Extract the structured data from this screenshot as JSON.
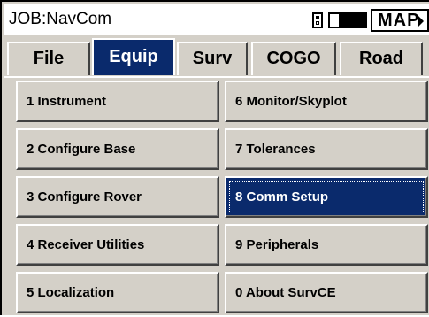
{
  "titlebar": {
    "job_title": "JOB:NavCom",
    "map_label": "MAP"
  },
  "tabs": [
    {
      "label": "File",
      "active": false
    },
    {
      "label": "Equip",
      "active": true
    },
    {
      "label": "Surv",
      "active": false
    },
    {
      "label": "COGO",
      "active": false
    },
    {
      "label": "Road",
      "active": false
    }
  ],
  "menu": {
    "left": [
      {
        "label": "1 Instrument"
      },
      {
        "label": "2 Configure Base"
      },
      {
        "label": "3 Configure Rover"
      },
      {
        "label": "4 Receiver Utilities"
      },
      {
        "label": "5 Localization"
      }
    ],
    "right": [
      {
        "label": "6 Monitor/Skyplot"
      },
      {
        "label": "7 Tolerances"
      },
      {
        "label": "8 Comm Setup",
        "selected": true
      },
      {
        "label": "9 Peripherals"
      },
      {
        "label": "0 About SurvCE"
      }
    ]
  },
  "colors": {
    "highlight": "#0a2a6c",
    "panel": "#d4d0c8"
  }
}
